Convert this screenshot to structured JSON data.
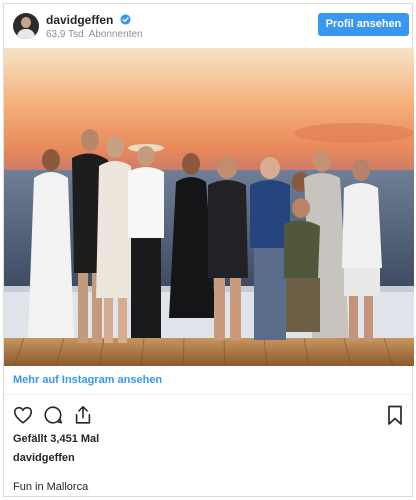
{
  "header": {
    "username": "davidgeffen",
    "followers": "63,9 Tsd. Abonnenten",
    "profile_button": "Profil ansehen"
  },
  "photo": {
    "alt_scene": "group-on-yacht-at-sunset"
  },
  "footer": {
    "more_link": "Mehr auf Instagram ansehen",
    "likes": "Gefällt 3,451 Mal",
    "caption_user": "davidgeffen",
    "caption_text": "Fun in Mallorca"
  },
  "colors": {
    "accent": "#3897f0",
    "text": "#262626",
    "muted": "#8e8e8e"
  },
  "icons": [
    "verified-badge-icon",
    "heart-icon",
    "comment-icon",
    "share-icon",
    "bookmark-icon"
  ]
}
